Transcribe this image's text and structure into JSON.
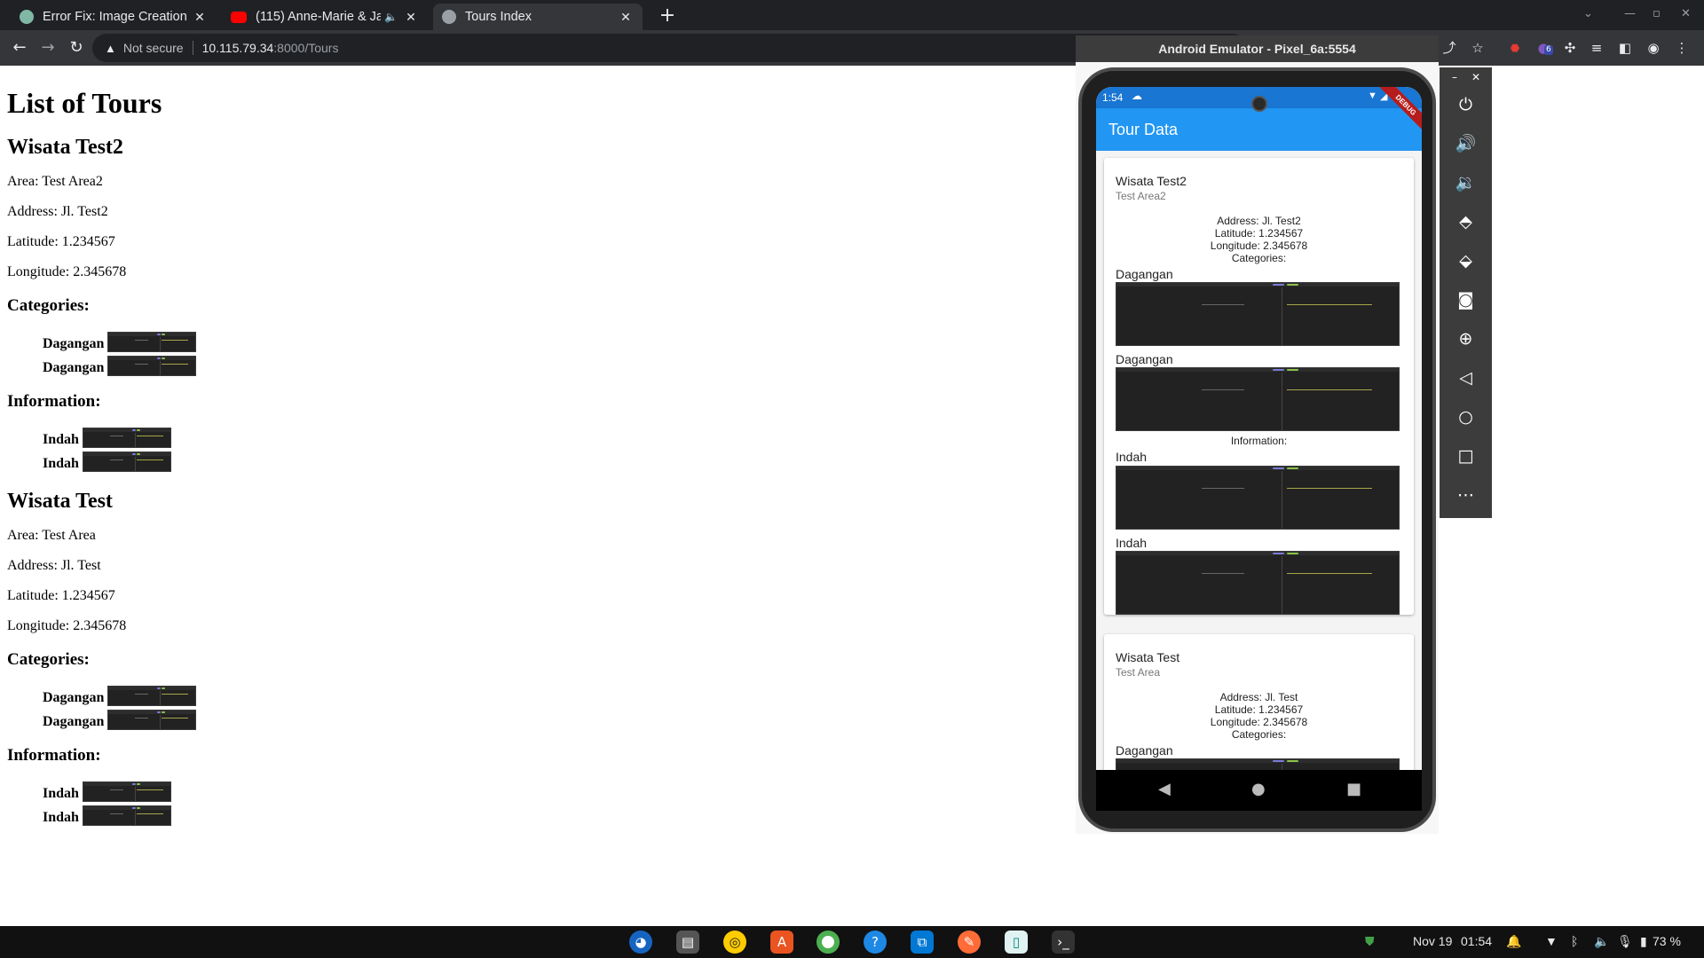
{
  "browser": {
    "tabs": [
      {
        "label": "Error Fix: Image Creation",
        "favicon_color": "#7fb8a4"
      },
      {
        "label": "(115) Anne-Marie & Ja",
        "favicon_color": "#ff0000",
        "audio_icon": "speaker-icon"
      },
      {
        "label": "Tours Index",
        "favicon_color": "#9aa0a6"
      }
    ],
    "security_label": "Not secure",
    "url_host": "10.115.79.34",
    "url_path": ":8000/Tours",
    "extension_badge": "6"
  },
  "page": {
    "heading": "List of Tours",
    "area_prefix": "Area: ",
    "address_prefix": "Address: ",
    "latitude_prefix": "Latitude: ",
    "longitude_prefix": "Longitude: ",
    "categories_heading": "Categories:",
    "information_heading": "Information:",
    "tours": [
      {
        "name": "Wisata Test2",
        "area": "Area: Test Area2",
        "address": "Address: Jl. Test2",
        "latitude": "Latitude: 1.234567",
        "longitude": "Longitude: 2.345678",
        "categories": [
          "Dagangan",
          "Dagangan"
        ],
        "information": [
          "Indah",
          "Indah"
        ]
      },
      {
        "name": "Wisata Test",
        "area": "Area: Test Area",
        "address": "Address: Jl. Test",
        "latitude": "Latitude: 1.234567",
        "longitude": "Longitude: 2.345678",
        "categories": [
          "Dagangan",
          "Dagangan"
        ],
        "information": [
          "Indah",
          "Indah"
        ]
      }
    ]
  },
  "emulator": {
    "title": "Android Emulator - Pixel_6a:5554",
    "status_time": "1:54",
    "debug_banner": "DEBUG",
    "app_title": "Tour Data",
    "cards": [
      {
        "title": "Wisata Test2",
        "subtitle": "Test Area2",
        "address": "Address: Jl. Test2",
        "latitude": "Latitude: 1.234567",
        "longitude": "Longitude: 2.345678",
        "categories_label": "Categories:",
        "category_items": [
          "Dagangan",
          "Dagangan"
        ],
        "information_label": "Information:",
        "information_items": [
          "Indah",
          "Indah"
        ]
      },
      {
        "title": "Wisata Test",
        "subtitle": "Test Area",
        "address": "Address: Jl. Test",
        "latitude": "Latitude: 1.234567",
        "longitude": "Longitude: 2.345678",
        "categories_label": "Categories:",
        "category_items": [
          "Dagangan"
        ]
      }
    ],
    "side_controls": [
      "power-icon",
      "volume-up-icon",
      "volume-down-icon",
      "rotate-left-icon",
      "rotate-right-icon",
      "camera-icon",
      "zoom-icon",
      "back-icon",
      "home-icon",
      "overview-icon",
      "more-icon"
    ]
  },
  "taskbar": {
    "date": "Nov 19",
    "time": "01:54",
    "battery": "73 %",
    "apps": [
      "firefox-icon",
      "files-icon",
      "rhythmbox-icon",
      "software-center-icon",
      "chrome-icon",
      "help-icon",
      "vscode-icon",
      "postman-icon",
      "emulator-icon",
      "terminal-icon"
    ]
  }
}
